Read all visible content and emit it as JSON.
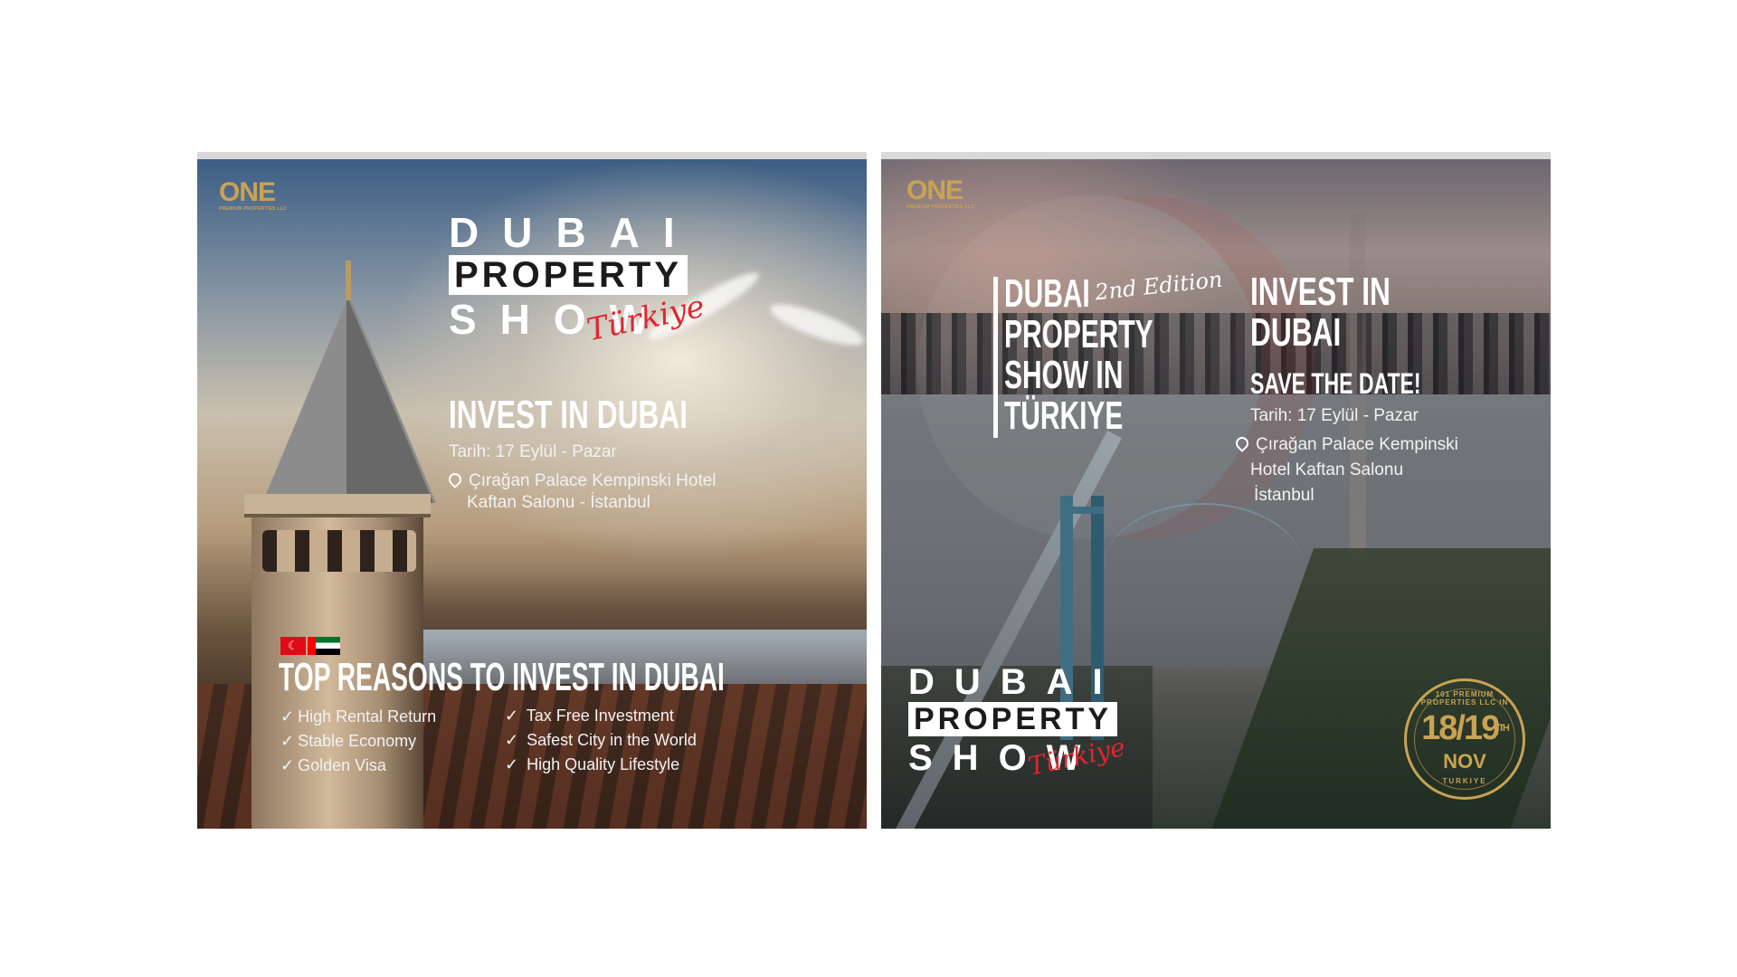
{
  "card1": {
    "logo": {
      "mark": "ONE",
      "sub": "PREMIUM PROPERTIES LLC"
    },
    "title": {
      "line1": "DUBAI",
      "line2": "PROPERTY",
      "line3": "SHOW",
      "script": "Türkiye"
    },
    "invest_heading": "INVEST IN DUBAI",
    "date_line": "Tarih: 17 Eylül - Pazar",
    "location_line1": "Çırağan Palace Kempinski Hotel",
    "location_line2": "Kaftan Salonu - İstanbul",
    "reasons_title": "TOP REASONS TO INVEST IN DUBAI",
    "reasons": [
      "High Rental Return",
      "Stable Economy",
      "Golden Visa",
      "Tax Free Investment",
      "Safest City in the World",
      "High Quality Lifestyle"
    ],
    "check_glyph": "✓"
  },
  "card2": {
    "logo": {
      "mark": "ONE",
      "sub": "PREMIUM PROPERTIES LLC"
    },
    "left_title": {
      "line1": "DUBAI",
      "line2": "PROPERTY",
      "line3": "SHOW IN",
      "line4": "TÜRKIYE",
      "script": "2nd Edition"
    },
    "invest_line1": "INVEST IN",
    "invest_line2": "DUBAI",
    "save_the_date": "SAVE THE DATE!",
    "date_line": "Tarih: 17 Eylül - Pazar",
    "location_line1": "Çırağan Palace Kempinski",
    "location_line2": "Hotel Kaftan Salonu",
    "location_line3": "İstanbul",
    "bottom_title": {
      "line1": "DUBAI",
      "line2": "PROPERTY",
      "line3": "SHOW",
      "script": "Türkiye"
    },
    "badge": {
      "ring_text": "101 PREMIUM PROPERTIES LLC IN",
      "date": "18/19",
      "suffix": "TH",
      "month": "NOV",
      "bottom": "TURKIYE"
    }
  },
  "colors": {
    "gold": "#c9a353",
    "accent_red": "#e0262f",
    "white": "#ffffff"
  }
}
